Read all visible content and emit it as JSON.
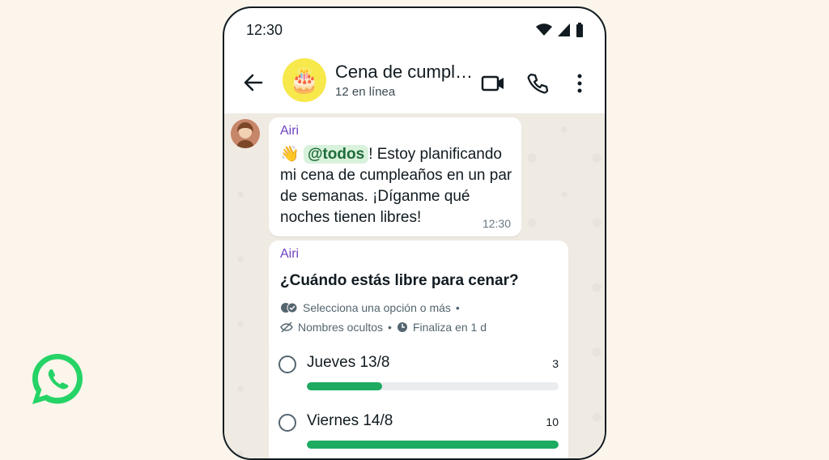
{
  "status_bar": {
    "time": "12:30"
  },
  "header": {
    "title": "Cena de cumpleaños",
    "subtitle": "12 en línea",
    "avatar_emoji": "🎂"
  },
  "messages": [
    {
      "sender": "Airi",
      "emoji": "👋",
      "mention": "@todos",
      "text_after_mention": "! Estoy planificando mi cena de cumpleaños en un par de semanas. ¡Díganme qué noches tienen libres!",
      "time": "12:30"
    }
  ],
  "poll": {
    "sender": "Airi",
    "question": "¿Cuándo estás libre para cenar?",
    "meta_1": "Selecciona una opción o más",
    "meta_2": "Nombres ocultos",
    "meta_3": "Finaliza en 1 d",
    "options": [
      {
        "label": "Jueves 13/8",
        "count": "3",
        "fraction": 0.3
      },
      {
        "label": "Viernes 14/8",
        "count": "10",
        "fraction": 1.0
      }
    ]
  },
  "colors": {
    "page_background": "#fcf5eb",
    "whatsapp_green": "#25d366",
    "poll_bar": "#1daa61",
    "sender_color": "#6f42c1",
    "chat_background": "#efeae2"
  },
  "icons": [
    "whatsapp-logo-icon",
    "signal-icon",
    "wifi-icon",
    "battery-icon",
    "back-arrow-icon",
    "video-call-icon",
    "phone-call-icon",
    "more-options-icon",
    "double-check-icon",
    "hidden-eye-icon",
    "clock-icon"
  ]
}
